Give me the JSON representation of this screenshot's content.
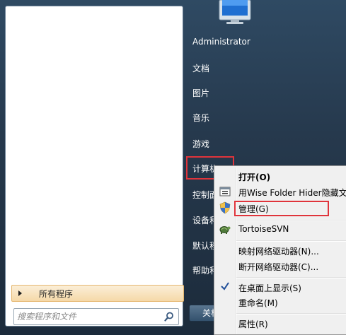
{
  "left_pane": {
    "all_programs_label": "所有程序",
    "search_placeholder": "搜索程序和文件"
  },
  "right_pane": {
    "items": [
      {
        "label": "Administrator"
      },
      {
        "label": "文档"
      },
      {
        "label": "图片"
      },
      {
        "label": "音乐"
      },
      {
        "label": "游戏"
      },
      {
        "label": "计算机"
      },
      {
        "label": "控制面"
      },
      {
        "label": "设备和"
      },
      {
        "label": "默认程"
      },
      {
        "label": "帮助和"
      }
    ],
    "shutdown_label": "关机"
  },
  "context_menu": {
    "items": [
      {
        "label": "打开(O)",
        "bold": true
      },
      {
        "label": "用Wise Folder Hider隐藏文"
      },
      {
        "label": "管理(G)"
      },
      {
        "label": "TortoiseSVN"
      },
      {
        "label": "映射网络驱动器(N)..."
      },
      {
        "label": "断开网络驱动器(C)..."
      },
      {
        "label": "在桌面上显示(S)"
      },
      {
        "label": "重命名(M)"
      },
      {
        "label": "属性(R)"
      }
    ]
  },
  "colors": {
    "highlight": "#e0343b",
    "all_programs_bg": "#f5d9a8",
    "menu_bg": "#f0f0f0"
  }
}
